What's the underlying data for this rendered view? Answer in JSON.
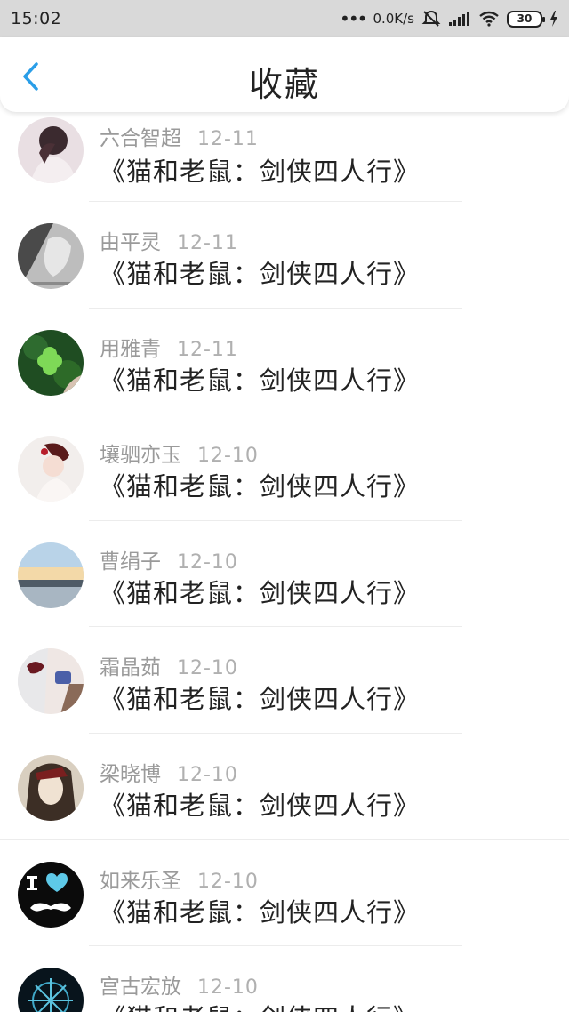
{
  "status_bar": {
    "time": "15:02",
    "speed": "0.0K/s",
    "battery": "30"
  },
  "header": {
    "title": "收藏",
    "back_icon": "chevron-left-icon",
    "accent_color": "#2a9ee8"
  },
  "items": [
    {
      "name": "六合智超",
      "date": "12-11",
      "title": "《猫和老鼠：剑侠四人行》"
    },
    {
      "name": "由平灵",
      "date": "12-11",
      "title": "《猫和老鼠：剑侠四人行》"
    },
    {
      "name": "用雅青",
      "date": "12-11",
      "title": "《猫和老鼠：剑侠四人行》"
    },
    {
      "name": "壤驷亦玉",
      "date": "12-10",
      "title": "《猫和老鼠：剑侠四人行》"
    },
    {
      "name": "曹绢子",
      "date": "12-10",
      "title": "《猫和老鼠：剑侠四人行》"
    },
    {
      "name": "霜晶茹",
      "date": "12-10",
      "title": "《猫和老鼠：剑侠四人行》"
    },
    {
      "name": "梁晓博",
      "date": "12-10",
      "title": "《猫和老鼠：剑侠四人行》"
    },
    {
      "name": "如来乐圣",
      "date": "12-10",
      "title": "《猫和老鼠：剑侠四人行》"
    },
    {
      "name": "宫古宏放",
      "date": "12-10",
      "title": "《猫和老鼠：剑侠四人行》"
    }
  ]
}
